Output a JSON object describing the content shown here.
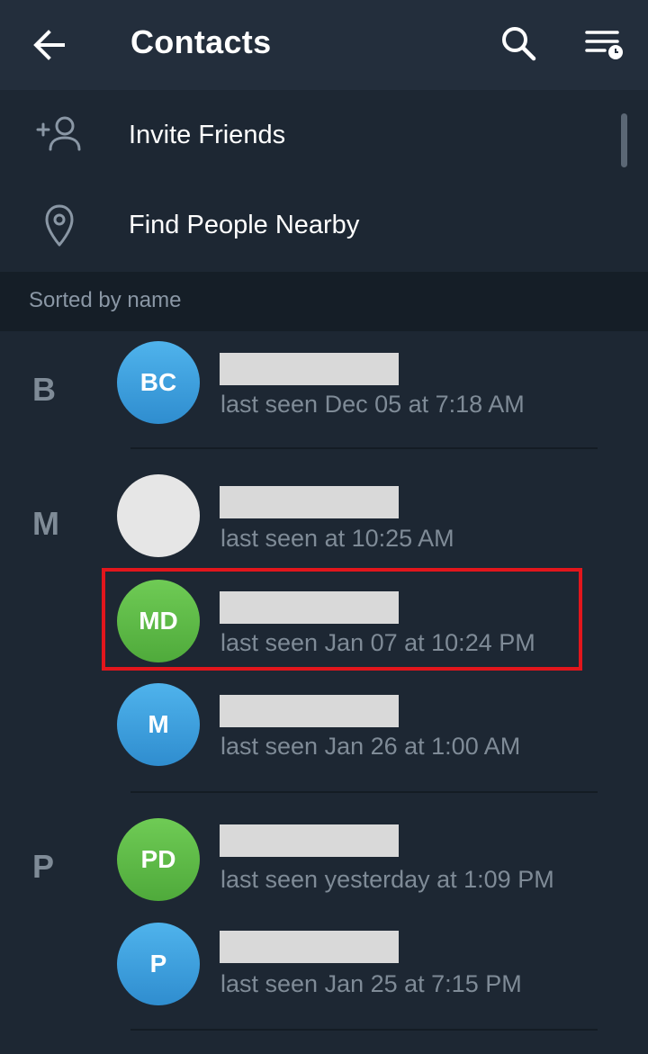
{
  "header": {
    "title": "Contacts",
    "back_icon": "arrow-left-icon",
    "search_icon": "search-icon",
    "sort_icon": "sort-list-clock-icon"
  },
  "actions": [
    {
      "label": "Invite Friends",
      "icon": "add-person-icon"
    },
    {
      "label": "Find People Nearby",
      "icon": "location-pin-icon"
    }
  ],
  "section_header": "Sorted by name",
  "groups": [
    {
      "letter": "B"
    },
    {
      "letter": "M"
    },
    {
      "letter": "P"
    }
  ],
  "contacts": [
    {
      "initials": "BC",
      "status": "last seen Dec 05 at 7:18 AM",
      "color": "#3f9fdb"
    },
    {
      "initials": "",
      "status": "last seen at 10:25 AM",
      "color": "#e6e6e6"
    },
    {
      "initials": "MD",
      "status": "last seen Jan 07 at 10:24 PM",
      "color": "#5fbd49"
    },
    {
      "initials": "M",
      "status": "last seen Jan 26 at 1:00 AM",
      "color": "#3f9fdb"
    },
    {
      "initials": "PD",
      "status": "last seen yesterday at 1:09 PM",
      "color": "#5fbd49"
    },
    {
      "initials": "P",
      "status": "last seen Jan 25 at 7:15 PM",
      "color": "#3f9fdb"
    }
  ],
  "colors": {
    "background": "#1d2733",
    "topbar": "#232e3c",
    "section_header_bg": "#151e27",
    "highlight_border": "#e2161c",
    "muted_text": "#7f8b97"
  }
}
